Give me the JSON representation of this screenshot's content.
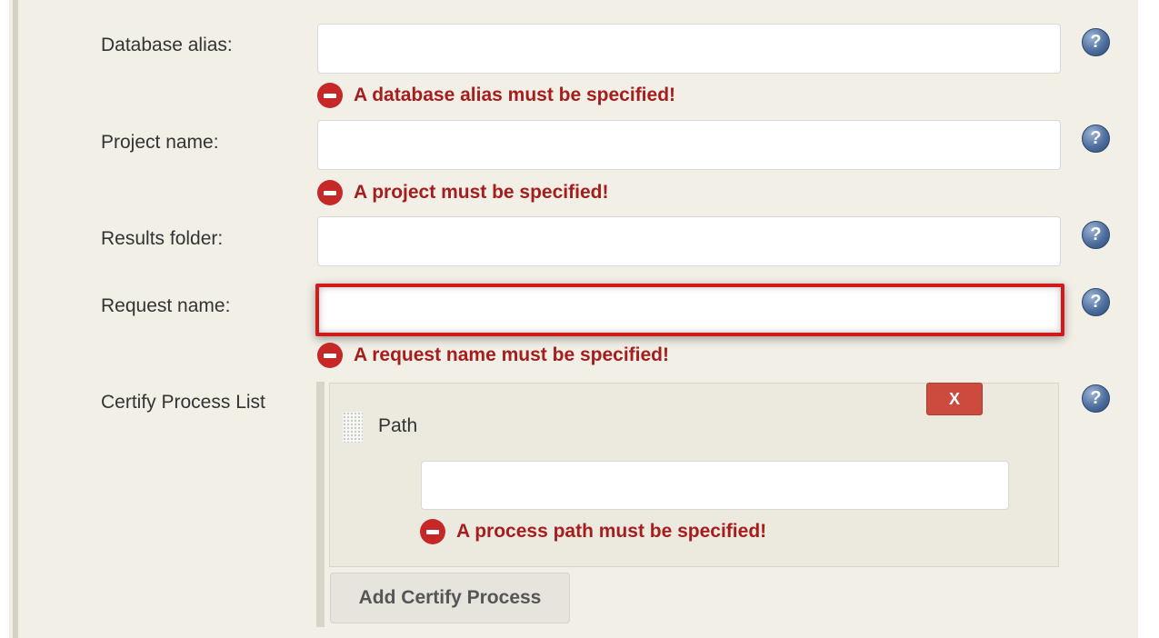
{
  "form": {
    "database_alias": {
      "label": "Database alias:",
      "value": "",
      "error": "A database alias must be specified!"
    },
    "project_name": {
      "label": "Project name:",
      "value": "",
      "error": "A project must be specified!"
    },
    "results_folder": {
      "label": "Results folder:",
      "value": ""
    },
    "request_name": {
      "label": "Request name:",
      "value": "",
      "error": "A request name must be specified!"
    },
    "certify_process_list": {
      "label": "Certify Process List",
      "delete_label": "X",
      "path_label": "Path",
      "path_value": "",
      "path_error": "A process path must be specified!",
      "add_button_label": "Add Certify Process"
    },
    "help_glyph": "?"
  },
  "colors": {
    "error_text": "#a71d1d",
    "error_border": "#d11a1a",
    "delete_button": "#cd4a3e",
    "panel_background": "#f1efe6"
  },
  "icons": {
    "help": "help-icon",
    "error": "error-minus-icon",
    "drag": "drag-handle-icon"
  }
}
